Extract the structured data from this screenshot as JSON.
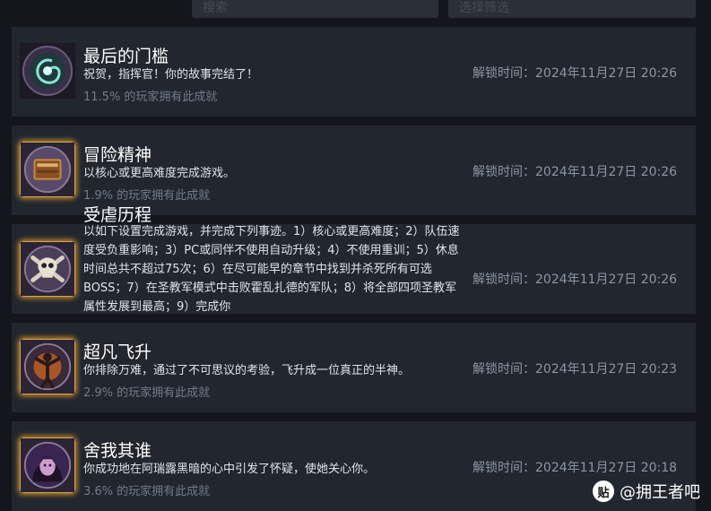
{
  "top_controls": {
    "left_text": "搜索",
    "right_text": "选择筛选"
  },
  "achievements": [
    {
      "icon": "galaxy-icon",
      "title": "最后的门槛",
      "description": "祝贺，指挥官！你的故事完结了！",
      "percent": "11.5% 的玩家拥有此成就",
      "unlock": "解锁时间：2024年11月27日 20:26"
    },
    {
      "icon": "book-icon",
      "title": "冒险精神",
      "description": "以核心或更高难度完成游戏。",
      "percent": "1.9% 的玩家拥有此成就",
      "unlock": "解锁时间：2024年11月27日 20:26"
    },
    {
      "icon": "skull-icon",
      "title": "受虐历程",
      "description": "以如下设置完成游戏，并完成下列事迹。1）核心或更高难度；2）队伍速度受负重影响；3）PC或同伴不使用自动升级；4）不使用重训；5）休息时间总共不超过75次；6）在尽可能早的章节中找到并杀死所有可选BOSS；7）在圣教军模式中击败霍乱扎德的军队；8）将全部四项圣教军属性发展到最高；9）完成你",
      "percent": "",
      "unlock": "解锁时间：2024年11月27日 20:26"
    },
    {
      "icon": "ascending-figure-icon",
      "title": "超凡飞升",
      "description": "你排除万难，通过了不可思议的考验，飞升成一位真正的半神。",
      "percent": "2.9% 的玩家拥有此成就",
      "unlock": "解锁时间：2024年11月27日 20:23"
    },
    {
      "icon": "dark-portrait-icon",
      "title": "舍我其谁",
      "description": "你成功地在阿瑞露黑暗的心中引发了怀疑，使她关心你。",
      "percent": "3.6% 的玩家拥有此成就",
      "unlock": "解锁时间：2024年11月27日 20:18"
    }
  ],
  "watermark": {
    "badge": "贴",
    "text": "@拥王者吧"
  }
}
